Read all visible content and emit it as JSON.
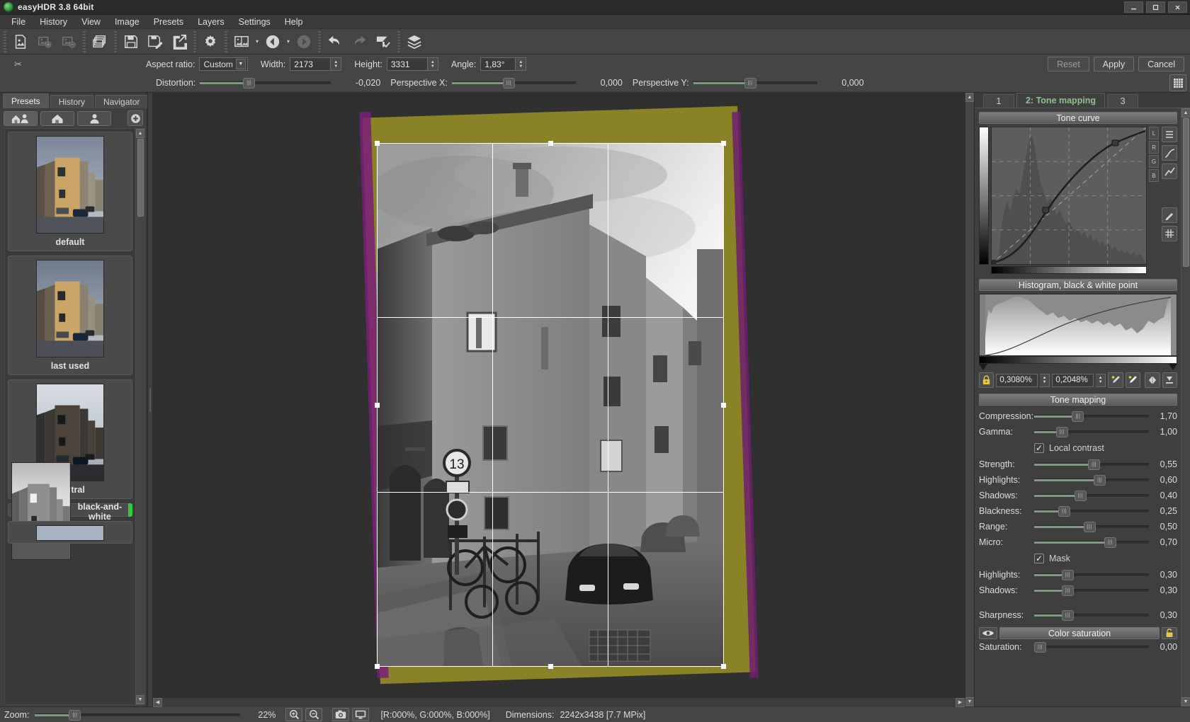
{
  "window": {
    "title": "easyHDR 3.8 64bit",
    "buttons": {
      "minimize": "—",
      "maximize": "▢",
      "close": "✕"
    }
  },
  "menu": {
    "items": [
      "File",
      "History",
      "View",
      "Image",
      "Presets",
      "Layers",
      "Settings",
      "Help"
    ]
  },
  "toolbar": {
    "icons": [
      "open-image-icon",
      "add-image-icon",
      "remove-image-icon",
      "batch-images-icon",
      "save-icon",
      "save-as-icon",
      "export-icon",
      "settings-gear-icon",
      "compare-images-icon",
      "previous-image-icon",
      "next-image-icon",
      "undo-icon",
      "redo-icon",
      "crop-tool-icon",
      "layers-icon"
    ]
  },
  "crop_options": {
    "aspect_ratio_label": "Aspect ratio:",
    "aspect_ratio_value": "Custom",
    "width_label": "Width:",
    "width_value": "2173",
    "height_label": "Height:",
    "height_value": "3331",
    "angle_label": "Angle:",
    "angle_value": "1,83°",
    "distortion_label": "Distortion:",
    "distortion_value": "-0,020",
    "perspective_x_label": "Perspective X:",
    "perspective_x_value": "0,000",
    "perspective_y_label": "Perspective Y:",
    "perspective_y_value": "0,000",
    "reset_label": "Reset",
    "apply_label": "Apply",
    "cancel_label": "Cancel",
    "grid_icon": "grid-icon"
  },
  "left_panel": {
    "tabs": [
      {
        "label": "Presets",
        "active": true
      },
      {
        "label": "History",
        "active": false
      },
      {
        "label": "Navigator",
        "active": false
      }
    ],
    "filters": [
      {
        "name": "all-presets-filter",
        "icon": "home-person-icon",
        "active": true
      },
      {
        "name": "builtin-presets-filter",
        "icon": "home-icon",
        "active": false
      },
      {
        "name": "user-presets-filter",
        "icon": "person-icon",
        "active": false
      }
    ],
    "add_button": {
      "name": "add-preset-button",
      "icon": "plus-icon"
    },
    "presets": [
      {
        "name": "default",
        "selected": false,
        "style": "color"
      },
      {
        "name": "last used",
        "selected": false,
        "style": "color"
      },
      {
        "name": "neutral",
        "selected": false,
        "style": "dark"
      },
      {
        "name": "black-and-white",
        "selected": true,
        "style": "bw"
      },
      {
        "name": "",
        "selected": false,
        "style": "color"
      }
    ]
  },
  "right_panel": {
    "tabs": [
      {
        "label": "1",
        "active": false
      },
      {
        "label": "2: Tone mapping",
        "active": true
      },
      {
        "label": "3",
        "active": false
      }
    ],
    "tone_curve": {
      "header": "Tone curve",
      "channel_buttons": [
        "L",
        "R",
        "G",
        "B"
      ],
      "tool_buttons": [
        "list-curve-icon",
        "curve-smooth-icon",
        "curve-linear-icon",
        "pencil-icon",
        "grid-toggle-icon"
      ]
    },
    "histogram": {
      "header": "Histogram, black & white point",
      "lock_icon": "lock-icon",
      "black_point": "0,3080%",
      "white_point": "0,2048%",
      "picker_black_icon": "eyedropper-black-icon",
      "picker_white_icon": "eyedropper-white-icon",
      "auto_icon": "auto-levels-icon",
      "reset_icon": "reset-levels-icon"
    },
    "tone_mapping": {
      "header": "Tone mapping",
      "sliders": [
        {
          "label": "Compression:",
          "value": "1,70",
          "pos": 0.38
        },
        {
          "label": "Gamma:",
          "value": "1,00",
          "pos": 0.24
        }
      ],
      "local_contrast": {
        "label": "Local contrast",
        "checked": true
      },
      "local_sliders": [
        {
          "label": "Strength:",
          "value": "0,55",
          "pos": 0.52
        },
        {
          "label": "Highlights:",
          "value": "0,60",
          "pos": 0.57
        },
        {
          "label": "Shadows:",
          "value": "0,40",
          "pos": 0.4
        },
        {
          "label": "Blackness:",
          "value": "0,25",
          "pos": 0.26
        },
        {
          "label": "Range:",
          "value": "0,50",
          "pos": 0.48
        },
        {
          "label": "Micro:",
          "value": "0,70",
          "pos": 0.66
        }
      ],
      "mask": {
        "label": "Mask",
        "checked": true
      },
      "mask_sliders": [
        {
          "label": "Highlights:",
          "value": "0,30",
          "pos": 0.29
        },
        {
          "label": "Shadows:",
          "value": "0,30",
          "pos": 0.29
        }
      ],
      "sharpness": {
        "label": "Sharpness:",
        "value": "0,30",
        "pos": 0.29
      }
    },
    "color_saturation": {
      "header": "Color saturation",
      "eye_icon": "eye-icon",
      "lock_icon": "unlock-icon",
      "saturation": {
        "label": "Saturation:",
        "value": "0,00",
        "pos": 0.02
      }
    }
  },
  "status_bar": {
    "zoom_label": "Zoom:",
    "zoom_value": "22%",
    "zoom_slider_pos": 0.18,
    "zoom_in_icon": "zoom-in-icon",
    "zoom_out_icon": "zoom-out-icon",
    "snapshot_icon": "camera-icon",
    "fullscreen_icon": "monitor-icon",
    "rgb_readout": "[R:000%, G:000%, B:000%]",
    "dimensions_label": "Dimensions:",
    "dimensions_value": "2242x3438 [7.7 MPix]"
  },
  "colors": {
    "accent_green": "#8fbf8f",
    "selection_green": "#2ecc3f",
    "slider_green": "#7e9b7e",
    "panel_bg": "#3f3f3f",
    "canvas_bg": "#303030",
    "crop_border_olive": "#8a8226"
  }
}
